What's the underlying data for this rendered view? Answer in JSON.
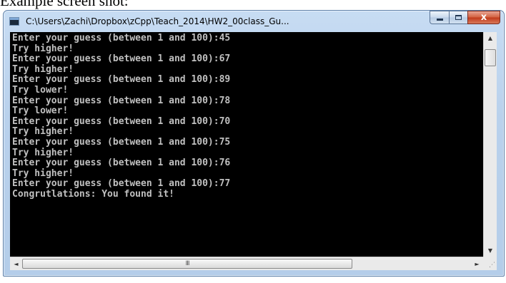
{
  "caption": "Example screen shot:",
  "window": {
    "title": "C:\\Users\\Zachi\\Dropbox\\zCpp\\Teach_2014\\HW2_00class_Gu...",
    "close_glyph": "x",
    "icon": "console-app-icon"
  },
  "console": {
    "lines": [
      "Enter your guess (between 1 and 100):45",
      "Try higher!",
      "Enter your guess (between 1 and 100):67",
      "Try higher!",
      "Enter your guess (between 1 and 100):89",
      "Try lower!",
      "Enter your guess (between 1 and 100):78",
      "Try lower!",
      "Enter your guess (between 1 and 100):70",
      "Try higher!",
      "Enter your guess (between 1 and 100):75",
      "Try higher!",
      "Enter your guess (between 1 and 100):76",
      "Try higher!",
      "Enter your guess (between 1 and 100):77",
      "Congrutlations: You found it!"
    ],
    "background": "#000000",
    "text_color": "#c0c0c0"
  },
  "scrollbars": {
    "up_arrow": "▲",
    "down_arrow": "▼",
    "left_arrow": "◄",
    "right_arrow": "►",
    "grip": "III"
  }
}
